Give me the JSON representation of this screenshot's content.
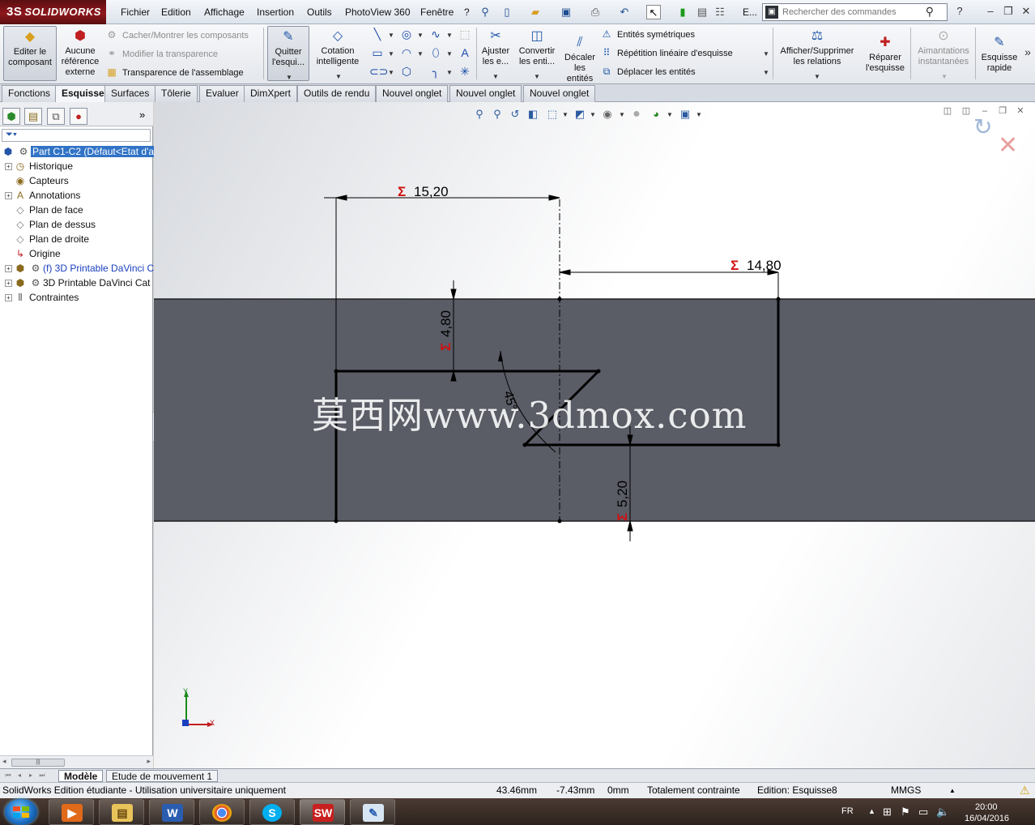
{
  "app": {
    "logo_text": "SOLIDWORKS",
    "logo_mark": "3S"
  },
  "menu": {
    "items": [
      "Fichier",
      "Edition",
      "Affichage",
      "Insertion",
      "Outils",
      "PhotoView 360",
      "Fenêtre",
      "?"
    ],
    "more_label": "E...",
    "search_placeholder": "Rechercher des commandes",
    "help_icon": "?"
  },
  "ribbon": {
    "edit_component": "Editer le composant",
    "no_external_ref": "Aucune référence externe",
    "hide_show": "Cacher/Montrer les composants",
    "change_transparency": "Modifier la transparence",
    "assembly_transparency": "Transparence de l'assemblage",
    "exit_sketch": "Quitter l'esqui...",
    "smart_dimension": "Cotation intelligente",
    "trim": "Ajuster les e...",
    "convert": "Convertir les enti...",
    "offset": "Décaler les entités",
    "mirror": "Entités symétriques",
    "linear_pattern": "Répétition linéaire d'esquisse",
    "move_entities": "Déplacer les entités",
    "relations": "Afficher/Supprimer les relations",
    "repair": "Réparer l'esquisse",
    "snaps": "Aimantations instantanées",
    "rapid_sketch": "Esquisse rapide"
  },
  "tabs": [
    "Fonctions",
    "Esquisse",
    "Surfaces",
    "Tôlerie",
    "Evaluer",
    "DimXpert",
    "Outils de rendu",
    "Nouvel onglet",
    "Nouvel onglet",
    "Nouvel onglet"
  ],
  "active_tab": "Esquisse",
  "tree": {
    "root": "Part C1-C2  (Défaut<Etat d'a",
    "items": [
      {
        "label": "Historique",
        "expand": true
      },
      {
        "label": "Capteurs",
        "expand": false
      },
      {
        "label": "Annotations",
        "expand": true
      },
      {
        "label": "Plan de face",
        "expand": false
      },
      {
        "label": "Plan de dessus",
        "expand": false
      },
      {
        "label": "Plan de droite",
        "expand": false
      },
      {
        "label": "Origine",
        "expand": false
      },
      {
        "label": "(f) 3D Printable DaVinci C",
        "expand": true
      },
      {
        "label": "3D Printable DaVinci Cat",
        "expand": true
      },
      {
        "label": "Contraintes",
        "expand": true
      }
    ]
  },
  "sketch": {
    "dim_top": "15,20",
    "dim_right": "14,80",
    "dim_left_vertical": "4,80",
    "dim_angle": "45°",
    "dim_bottom_vertical": "5,20",
    "sigma": "Σ",
    "axis_x": "X",
    "axis_y": "Y"
  },
  "watermark": "莫西网www.3dmox.com",
  "bottom_tabs": [
    "Modèle",
    "Etude de mouvement 1"
  ],
  "status": {
    "edition": "SolidWorks Edition étudiante - Utilisation universitaire uniquement",
    "x": "43.46mm",
    "y": "-7.43mm",
    "z": "0mm",
    "constraint": "Totalement contrainte",
    "editing": "Edition: Esquisse8",
    "units": "MMGS"
  },
  "taskbar": {
    "lang": "FR",
    "time": "20:00",
    "date": "16/04/2016"
  },
  "colors": {
    "brand": "#8d171b",
    "part_body": "#5a5c66",
    "sigma_red": "#d01010",
    "selection_blue": "#3173c6"
  }
}
